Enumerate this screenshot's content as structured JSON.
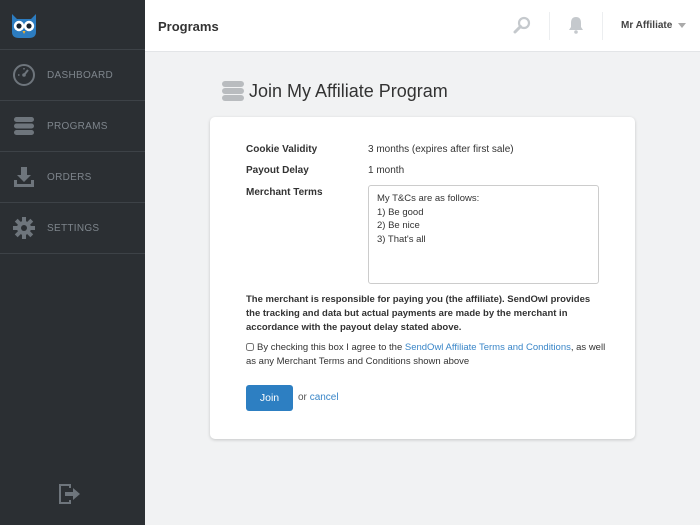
{
  "sidebar": {
    "items": [
      {
        "label": "DASHBOARD",
        "icon": "speedometer-icon"
      },
      {
        "label": "PROGRAMS",
        "icon": "database-stack-icon"
      },
      {
        "label": "ORDERS",
        "icon": "download-tray-icon"
      },
      {
        "label": "SETTINGS",
        "icon": "gear-icon"
      }
    ]
  },
  "header": {
    "title": "Programs",
    "user_name": "Mr Affiliate"
  },
  "main": {
    "heading": "Join My Affiliate Program",
    "cookie_label": "Cookie Validity",
    "cookie_value": "3 months (expires after first sale)",
    "payout_label": "Payout Delay",
    "payout_value": "1 month",
    "terms_label": "Merchant Terms",
    "terms_text": "My T&Cs are as follows:\n1) Be good\n2) Be nice\n3) That's all",
    "notice": "The merchant is responsible for paying you (the affiliate). SendOwl provides the tracking and data but actual payments are made by the merchant in accordance with the payout delay stated above.",
    "agree_prefix": "By checking this box I agree to the ",
    "agree_link": "SendOwl Affiliate Terms and Conditions",
    "agree_suffix": ", as well as any Merchant Terms and Conditions shown above",
    "join_label": "Join",
    "or_text": "or",
    "cancel_label": "cancel"
  },
  "colors": {
    "sidebar_bg": "#2b2f33",
    "accent": "#2d7fc2",
    "link": "#3a86c8",
    "page_bg": "#f1f2f3"
  }
}
